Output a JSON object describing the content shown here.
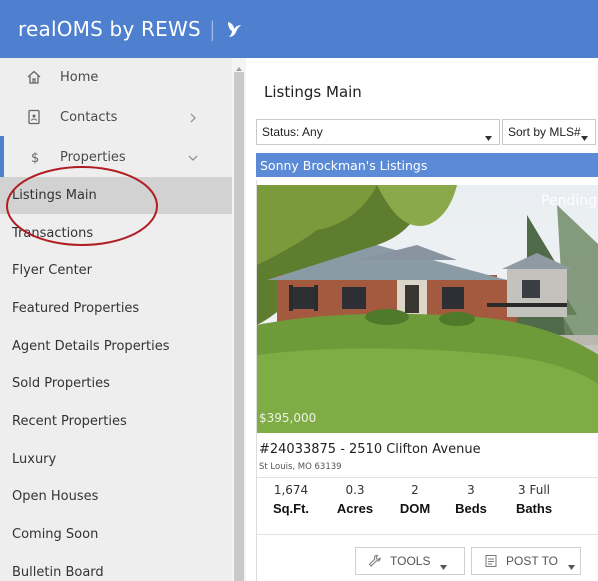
{
  "header": {
    "brand": "realOMS by REWS",
    "separator": "|",
    "logo_icon": "bird-logo-icon",
    "bg_color": "#4f7fcf"
  },
  "sidebar": {
    "nav": [
      {
        "label": "Home",
        "icon": "home-icon"
      },
      {
        "label": "Contacts",
        "icon": "contact-card-icon",
        "chevron": "chevron-right-icon"
      },
      {
        "label": "Properties",
        "icon": "dollar-icon",
        "chevron": "chevron-down-icon"
      }
    ],
    "sub_items": [
      "Listings Main",
      "Transactions",
      "Flyer Center",
      "Featured Properties",
      "Agent Details Properties",
      "Sold Properties",
      "Recent Properties",
      "Luxury",
      "Open Houses",
      "Coming Soon",
      "Bulletin Board"
    ],
    "active_item": "Listings Main"
  },
  "main": {
    "title": "Listings Main",
    "filters": {
      "status": "Status: Any",
      "sort": "Sort by MLS#"
    },
    "section_header": "Sonny Brockman's Listings",
    "listing": {
      "status": "Pending",
      "price": "$395,000",
      "address": "#24033875 - 2510 Clifton Avenue",
      "city": "St Louis, MO 63139",
      "stats": [
        {
          "value": "1,674",
          "label": "Sq.Ft."
        },
        {
          "value": "0.3",
          "label": "Acres"
        },
        {
          "value": "2",
          "label": "DOM"
        },
        {
          "value": "3",
          "label": "Beds"
        },
        {
          "value": "3 Full",
          "label": "Baths"
        }
      ],
      "tools_label": "TOOLS",
      "post_label": "POST TO"
    }
  },
  "colors": {
    "accent": "#4f7fcf",
    "section_header": "#5b8bd6",
    "annotation": "#b01e23"
  }
}
